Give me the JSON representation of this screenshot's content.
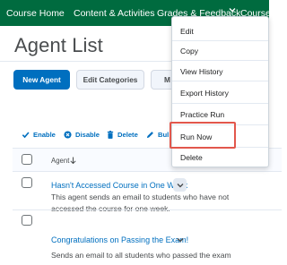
{
  "top_nav": {
    "items": [
      "Course Home",
      "Content & Activities",
      "Grades & Feedback",
      "Course"
    ],
    "bg_color": "#006b3f"
  },
  "page_title": "Agent List",
  "buttons": {
    "new_agent": "New Agent",
    "edit_categories": "Edit Categories",
    "partial": "M"
  },
  "toolbar": {
    "enable": "Enable",
    "disable": "Disable",
    "delete": "Delete",
    "bulk": "Bul"
  },
  "table": {
    "header": "Agent",
    "rows": [
      {
        "name": "Hasn't Accessed Course in One Week",
        "description": "This agent sends an email to students who have not accessed the course for one week."
      },
      {
        "name": "Congratulations on Passing the Exam!",
        "description": "Sends an email to all students who passed the exam"
      }
    ]
  },
  "context_menu": {
    "items": [
      "Edit",
      "Copy",
      "View History",
      "Export History",
      "Practice Run",
      "Run Now",
      "Delete"
    ],
    "highlighted": "Run Now",
    "highlight_color": "#e2574c"
  },
  "colors": {
    "link": "#006fbf",
    "primary_button": "#006fbf"
  }
}
